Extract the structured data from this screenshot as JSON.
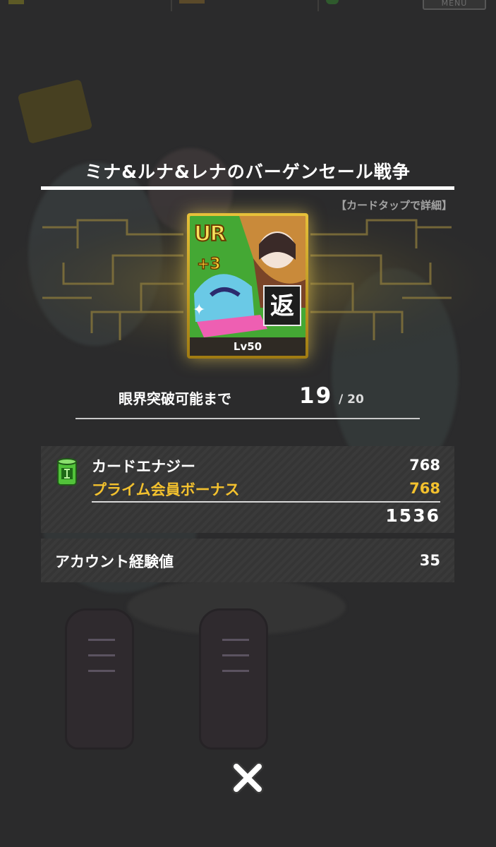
{
  "header": {
    "menu_label": "MENU"
  },
  "dialog": {
    "title": "ミナ&ルナ&レナのバーゲンセール戦争",
    "hint": "【カードタップで詳細】",
    "card": {
      "rarity": "UR",
      "plus": "+3",
      "badge": "返",
      "level": "Lv50"
    },
    "limit_break": {
      "label": "眼界突破可能まで",
      "current": "19",
      "max": "/ 20"
    },
    "energy": {
      "label": "カードエナジー",
      "value": "768",
      "bonus_label": "プライム会員ボーナス",
      "bonus_value": "768",
      "total": "1536"
    },
    "account_exp": {
      "label": "アカウント経験値",
      "value": "35"
    },
    "close_icon": "close-icon"
  },
  "colors": {
    "background": "#2b2b2c",
    "bonus_gold": "#f3c12e",
    "card_frame_gold": "#e7c13a"
  }
}
